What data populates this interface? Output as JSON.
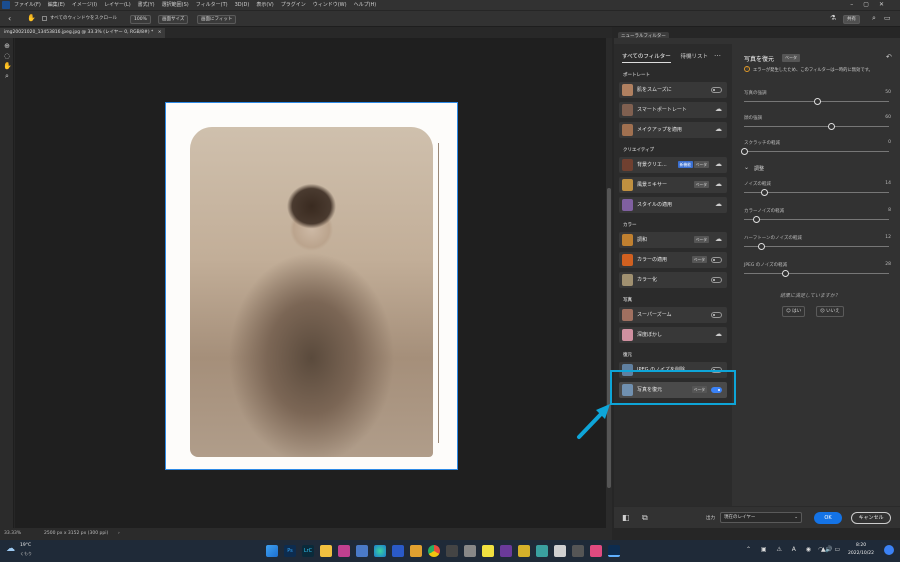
{
  "menu": [
    "ファイル(F)",
    "編集(E)",
    "イメージ(I)",
    "レイヤー(L)",
    "書式(Y)",
    "選択範囲(S)",
    "フィルター(T)",
    "3D(D)",
    "表示(V)",
    "プラグイン",
    "ウィンドウ(W)",
    "ヘルプ(H)"
  ],
  "options": {
    "scroll_all_label": "すべてのウィンドウをスクロール",
    "zoom_value": "100%",
    "fit_screen": "画面サイズ",
    "fill_screen": "画面にフィット",
    "share_label": "共有"
  },
  "document": {
    "tab_title": "img20021020_13453816.jpeg.jpg @ 33.3% (レイヤー 0, RGB/8#) *",
    "zoom_status": "33.33%",
    "size_status": "2500 px x 3152 px (300 ppi)"
  },
  "neural_filters": {
    "panel_title": "ニューラルフィルター",
    "tabs": [
      "すべてのフィルター",
      "待機リスト"
    ],
    "sections": [
      {
        "label": "ポートレート",
        "items": [
          {
            "name": "肌をスムーズに",
            "badges": [],
            "state": "off"
          },
          {
            "name": "スマートポートレート",
            "badges": [],
            "state": "cloud"
          },
          {
            "name": "メイクアップを適用",
            "badges": [],
            "state": "cloud"
          }
        ]
      },
      {
        "label": "クリエイティブ",
        "items": [
          {
            "name": "背景クリエ...",
            "badges": [
              "新機能",
              "ベータ"
            ],
            "state": "cloud"
          },
          {
            "name": "風景ミキサー",
            "badges": [
              "ベータ"
            ],
            "state": "cloud"
          },
          {
            "name": "スタイルの適用",
            "badges": [],
            "state": "cloud"
          }
        ]
      },
      {
        "label": "カラー",
        "items": [
          {
            "name": "調和",
            "badges": [
              "ベータ"
            ],
            "state": "cloud"
          },
          {
            "name": "カラーの適用",
            "badges": [
              "ベータ"
            ],
            "state": "off"
          },
          {
            "name": "カラー化",
            "badges": [],
            "state": "off"
          }
        ]
      },
      {
        "label": "写真",
        "items": [
          {
            "name": "スーパーズーム",
            "badges": [],
            "state": "off"
          },
          {
            "name": "深度ぼかし",
            "badges": [],
            "state": "cloud"
          }
        ]
      },
      {
        "label": "復元",
        "items": [
          {
            "name": "JPEG のノイズを削除",
            "badges": [],
            "state": "off"
          },
          {
            "name": "写真を復元",
            "badges": [
              "ベータ"
            ],
            "state": "on"
          }
        ]
      }
    ]
  },
  "restore": {
    "title": "写真を復元",
    "badge": "ベータ",
    "warning": "エラーが発生したため、このフィルターは一時的に無効です。",
    "sliders": [
      {
        "label": "写真の強調",
        "value": 50,
        "pct": 0.5
      },
      {
        "label": "顔の強調",
        "value": 60,
        "pct": 0.6
      },
      {
        "label": "スクラッチの軽減",
        "value": 0,
        "pct": 0.0
      }
    ],
    "adjust_label": "調整",
    "adjust_sliders": [
      {
        "label": "ノイズの軽減",
        "value": 14,
        "pct": 0.14
      },
      {
        "label": "カラーノイズの軽減",
        "value": 8,
        "pct": 0.08
      },
      {
        "label": "ハーフトーンのノイズの軽減",
        "value": 12,
        "pct": 0.12
      },
      {
        "label": "JPEG のノイズの軽減",
        "value": 28,
        "pct": 0.28
      }
    ],
    "feedback_q": "結果に満足していますか？",
    "yes": "はい",
    "no": "いいえ"
  },
  "bottom": {
    "output_label": "出力",
    "output_value": "現在のレイヤー",
    "ok": "OK",
    "cancel": "キャンセル"
  },
  "taskbar": {
    "temp": "19°C",
    "weather": "くもり",
    "time": "8:20",
    "date": "2022/10/22"
  }
}
